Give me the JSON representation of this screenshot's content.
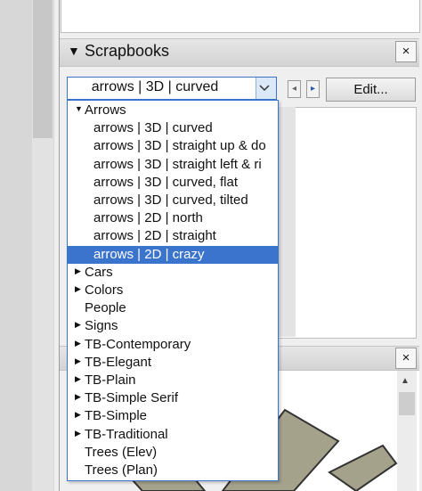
{
  "scrapbooks": {
    "title": "Scrapbooks",
    "close_label": "×",
    "combo_value": "arrows | 3D | curved",
    "edit_label": "Edit...",
    "nav_back_label": "◂",
    "nav_forward_label": "▸"
  },
  "lower_panel": {
    "close_label": "×"
  },
  "dropdown": {
    "items": [
      {
        "label": "Arrows",
        "level": 0,
        "expanded": true
      },
      {
        "label": "arrows | 3D | curved",
        "level": 1
      },
      {
        "label": "arrows | 3D | straight up & do",
        "level": 1
      },
      {
        "label": "arrows | 3D | straight left & ri",
        "level": 1
      },
      {
        "label": "arrows | 3D | curved, flat",
        "level": 1
      },
      {
        "label": "arrows | 3D | curved, tilted",
        "level": 1
      },
      {
        "label": "arrows | 2D | north",
        "level": 1
      },
      {
        "label": "arrows | 2D | straight",
        "level": 1
      },
      {
        "label": "arrows | 2D | crazy",
        "level": 1,
        "selected": true
      },
      {
        "label": "Cars",
        "level": 0,
        "expanded": false
      },
      {
        "label": "Colors",
        "level": 0,
        "expanded": false
      },
      {
        "label": "People",
        "level": 0,
        "noarrow": true
      },
      {
        "label": "Signs",
        "level": 0,
        "expanded": false
      },
      {
        "label": "TB-Contemporary",
        "level": 0,
        "expanded": false
      },
      {
        "label": "TB-Elegant",
        "level": 0,
        "expanded": false
      },
      {
        "label": "TB-Plain",
        "level": 0,
        "expanded": false
      },
      {
        "label": "TB-Simple Serif",
        "level": 0,
        "expanded": false
      },
      {
        "label": "TB-Simple",
        "level": 0,
        "expanded": false
      },
      {
        "label": "TB-Traditional",
        "level": 0,
        "expanded": false
      },
      {
        "label": "Trees (Elev)",
        "level": 0,
        "noarrow": true
      },
      {
        "label": "Trees (Plan)",
        "level": 0,
        "noarrow": true
      }
    ]
  },
  "icons": {
    "collapse": "triangle-down-icon",
    "expand": "triangle-right-icon",
    "chevron": "chevron-down-icon"
  },
  "colors": {
    "selection": "#3a74cc",
    "focus_border": "#3a73c8"
  }
}
